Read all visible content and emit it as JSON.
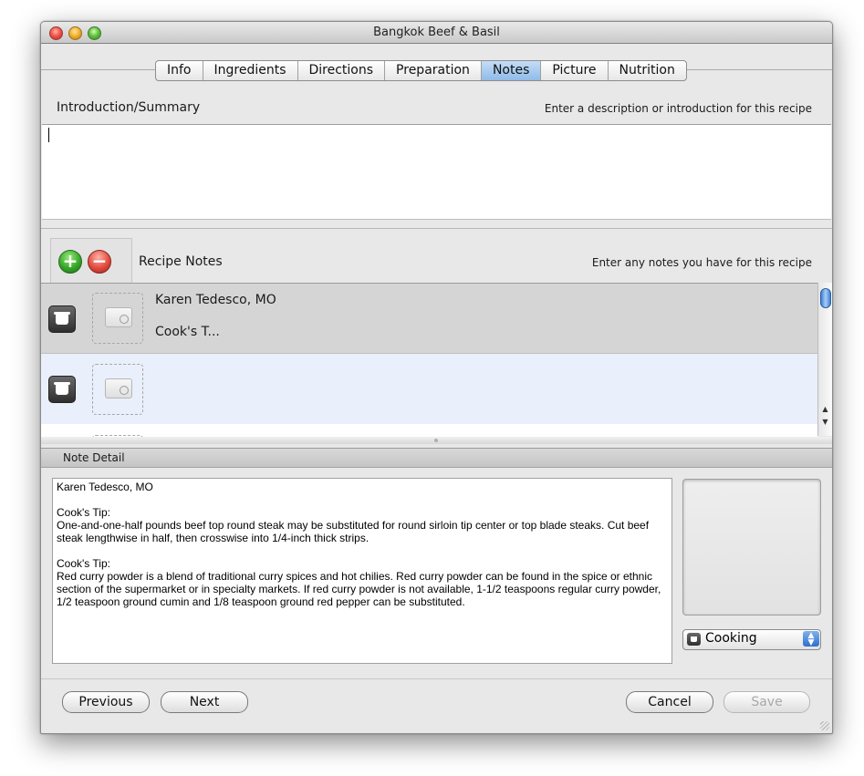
{
  "window": {
    "title": "Bangkok Beef & Basil"
  },
  "tabs": [
    {
      "label": "Info"
    },
    {
      "label": "Ingredients"
    },
    {
      "label": "Directions"
    },
    {
      "label": "Preparation"
    },
    {
      "label": "Notes",
      "active": true
    },
    {
      "label": "Picture"
    },
    {
      "label": "Nutrition"
    }
  ],
  "intro": {
    "label": "Introduction/Summary",
    "hint": "Enter a description or introduction for this recipe",
    "value": ""
  },
  "notes": {
    "label": "Recipe Notes",
    "hint": "Enter any notes you have for this recipe",
    "add_symbol": "+",
    "remove_symbol": "−",
    "items": [
      {
        "title": "Karen Tedesco, MO",
        "subtitle": "Cook's T...",
        "selected": true
      },
      {
        "title": "",
        "subtitle": ""
      }
    ]
  },
  "detail": {
    "header": "Note Detail",
    "text": "Karen Tedesco, MO\n\nCook's Tip:\nOne-and-one-half pounds beef top round steak may be substituted for round sirloin tip center or top blade steaks. Cut beef steak lengthwise in half, then crosswise into 1/4-inch thick strips.\n\nCook's Tip:\nRed curry powder is a blend of traditional curry spices and hot chilies. Red curry powder can be found in the spice or ethnic section of the supermarket or in specialty markets. If red curry powder is not available, 1-1/2 teaspoons regular curry powder, 1/2 teaspoon ground cumin and 1/8 teaspoon ground red pepper can be substituted.",
    "category": "Cooking"
  },
  "buttons": {
    "previous": "Previous",
    "next": "Next",
    "cancel": "Cancel",
    "save": "Save"
  }
}
